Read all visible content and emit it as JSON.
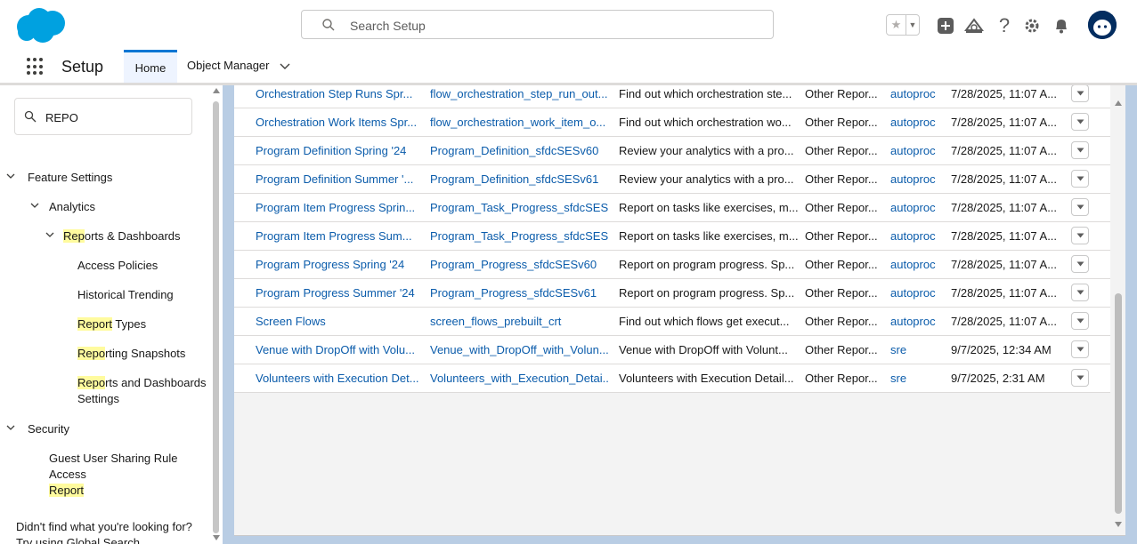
{
  "header": {
    "search_placeholder": "Search Setup"
  },
  "nav": {
    "app_name": "Setup",
    "tabs": [
      "Home",
      "Object Manager"
    ]
  },
  "sidebar": {
    "quick_find_value": "REPO",
    "feature_settings": "Feature Settings",
    "analytics": "Analytics",
    "reports_dashboards": {
      "hl": "Rep",
      "rest": "orts & Dashboards"
    },
    "access_policies": "Access Policies",
    "historical_trending": "Historical Trending",
    "report_types": {
      "hl": "Report",
      "rest": " Types"
    },
    "reporting_snapshots": {
      "hl": "Repo",
      "rest": "rting Snapshots"
    },
    "reports_dash_settings": {
      "hl": "Repo",
      "rest": "rts and Dashboards",
      "line2": "Settings"
    },
    "security": "Security",
    "guest_user": {
      "line1": "Guest User Sharing Rule Access",
      "hl": "Report"
    },
    "footer_line1": "Didn't find what you're looking for?",
    "footer_line2": "Try using Global Search."
  },
  "table": {
    "rows": [
      {
        "label": "Orchestration Step Runs Spr...",
        "api": "flow_orchestration_step_run_out...",
        "desc": "Find out which orchestration ste...",
        "category": "Other Repor...",
        "owner": "autoproc",
        "modified": "7/28/2025, 11:07 A..."
      },
      {
        "label": "Orchestration Work Items Spr...",
        "api": "flow_orchestration_work_item_o...",
        "desc": "Find out which orchestration wo...",
        "category": "Other Repor...",
        "owner": "autoproc",
        "modified": "7/28/2025, 11:07 A..."
      },
      {
        "label": "Program Definition Spring '24",
        "api": "Program_Definition_sfdcSESv60",
        "desc": "Review your analytics with a pro...",
        "category": "Other Repor...",
        "owner": "autoproc",
        "modified": "7/28/2025, 11:07 A..."
      },
      {
        "label": "Program Definition Summer '...",
        "api": "Program_Definition_sfdcSESv61",
        "desc": "Review your analytics with a pro...",
        "category": "Other Repor...",
        "owner": "autoproc",
        "modified": "7/28/2025, 11:07 A..."
      },
      {
        "label": "Program Item Progress Sprin...",
        "api": "Program_Task_Progress_sfdcSES...",
        "desc": "Report on tasks like exercises, m...",
        "category": "Other Repor...",
        "owner": "autoproc",
        "modified": "7/28/2025, 11:07 A..."
      },
      {
        "label": "Program Item Progress Sum...",
        "api": "Program_Task_Progress_sfdcSES...",
        "desc": "Report on tasks like exercises, m...",
        "category": "Other Repor...",
        "owner": "autoproc",
        "modified": "7/28/2025, 11:07 A..."
      },
      {
        "label": "Program Progress Spring '24",
        "api": "Program_Progress_sfdcSESv60",
        "desc": "Report on program progress. Sp...",
        "category": "Other Repor...",
        "owner": "autoproc",
        "modified": "7/28/2025, 11:07 A..."
      },
      {
        "label": "Program Progress Summer '24",
        "api": "Program_Progress_sfdcSESv61",
        "desc": "Report on program progress. Sp...",
        "category": "Other Repor...",
        "owner": "autoproc",
        "modified": "7/28/2025, 11:07 A..."
      },
      {
        "label": "Screen Flows",
        "api": "screen_flows_prebuilt_crt",
        "desc": "Find out which flows get execut...",
        "category": "Other Repor...",
        "owner": "autoproc",
        "modified": "7/28/2025, 11:07 A..."
      },
      {
        "label": "Venue with DropOff with Volu...",
        "api": "Venue_with_DropOff_with_Volun...",
        "desc": "Venue with DropOff with Volunt...",
        "category": "Other Repor...",
        "owner": "sre",
        "modified": "9/7/2025, 12:34 AM"
      },
      {
        "label": "Volunteers with Execution Det...",
        "api": "Volunteers_with_Execution_Detai...",
        "desc": "Volunteers with Execution Detail...",
        "category": "Other Repor...",
        "owner": "sre",
        "modified": "9/7/2025, 2:31 AM"
      }
    ]
  },
  "icons": {
    "logo": "salesforce-cloud-logo",
    "search": "search-icon",
    "favorite": "star-icon",
    "add": "plus-icon",
    "trailhead": "trailhead-icon",
    "help": "help-icon",
    "settings": "gear-icon",
    "notifications": "bell-icon",
    "avatar": "astro-avatar"
  },
  "colors": {
    "brand": "#00a1e0",
    "link": "#0b5cab",
    "highlight": "#fffb9e",
    "active_tab": "#0176d3"
  }
}
